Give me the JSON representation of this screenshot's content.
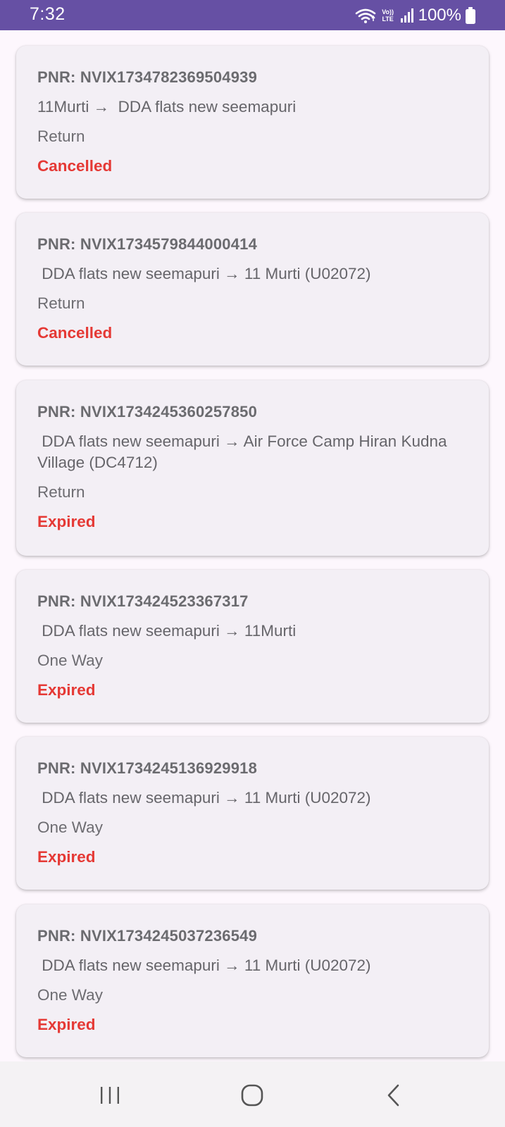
{
  "status_bar": {
    "time": "7:32",
    "battery_percent": "100%",
    "network_label": "Vo)) LTE",
    "icons": [
      "wifi-icon",
      "volte-icon",
      "signal-icon",
      "battery-icon"
    ]
  },
  "colors": {
    "status_bar_bg": "#6650a4",
    "status_text": "#e53935",
    "card_bg": "#f3eff5",
    "page_bg": "#fdf7fd"
  },
  "bookings": [
    {
      "pnr": "PNR: NVIX1734782369504939",
      "route": "11Murti →  DDA flats new seemapuri",
      "trip_type": "Return",
      "status": "Cancelled"
    },
    {
      "pnr": "PNR: NVIX1734579844000414",
      "route": " DDA flats new seemapuri → 11 Murti (U02072)",
      "trip_type": "Return",
      "status": "Cancelled"
    },
    {
      "pnr": "PNR: NVIX1734245360257850",
      "route": " DDA flats new seemapuri → Air Force Camp Hiran Kudna Village (DC4712)",
      "trip_type": "Return",
      "status": "Expired"
    },
    {
      "pnr": "PNR: NVIX173424523367317",
      "route": " DDA flats new seemapuri → 11Murti",
      "trip_type": "One Way",
      "status": "Expired"
    },
    {
      "pnr": "PNR: NVIX1734245136929918",
      "route": " DDA flats new seemapuri → 11 Murti (U02072)",
      "trip_type": "One Way",
      "status": "Expired"
    },
    {
      "pnr": "PNR: NVIX1734245037236549",
      "route": " DDA flats new seemapuri → 11 Murti (U02072)",
      "trip_type": "One Way",
      "status": "Expired"
    }
  ],
  "navigation": {
    "icons": [
      "recent-apps-icon",
      "home-icon",
      "back-icon"
    ]
  }
}
